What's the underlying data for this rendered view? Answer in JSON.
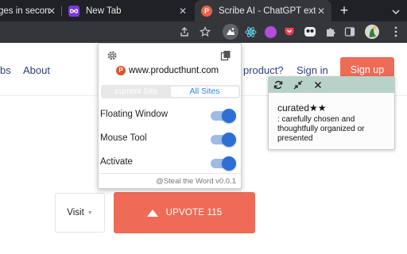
{
  "browser": {
    "tabs": [
      {
        "title": "ges in secon",
        "favicon": "generic"
      },
      {
        "title": "New Tab",
        "favicon": "new-tab-icon"
      },
      {
        "title": "Scribe AI - ChatGPT exten",
        "favicon": "producthunt-icon"
      }
    ],
    "toolbar_icons": [
      "share-icon",
      "star-icon",
      "steal-the-word-extension-icon",
      "react-devtools-icon",
      "extension-purple-icon",
      "pocket-icon",
      "ghost-icon",
      "puzzle-icon",
      "sidebar-icon",
      "profile-avatar",
      "menu-kebab-icon"
    ]
  },
  "page": {
    "nav": {
      "bs": "bs",
      "about": "About",
      "product": "product?",
      "sign_in": "Sign in",
      "sign_up": "Sign up"
    },
    "visit": "Visit",
    "upvote": "UPVOTE 115",
    "accent_color": "#ee6c57"
  },
  "popup": {
    "site": "www.producthunt.com",
    "segments": {
      "current": "current Site",
      "all": "All Sites"
    },
    "rows": [
      {
        "label": "Floating Window",
        "on": true
      },
      {
        "label": "Mouse Tool",
        "on": true
      },
      {
        "label": "Activate",
        "on": true
      }
    ],
    "footer": "@Steal the Word v0.0.1"
  },
  "word_card": {
    "word": "curated★★",
    "definition": ": carefully chosen and thoughtfully organized or presented"
  }
}
